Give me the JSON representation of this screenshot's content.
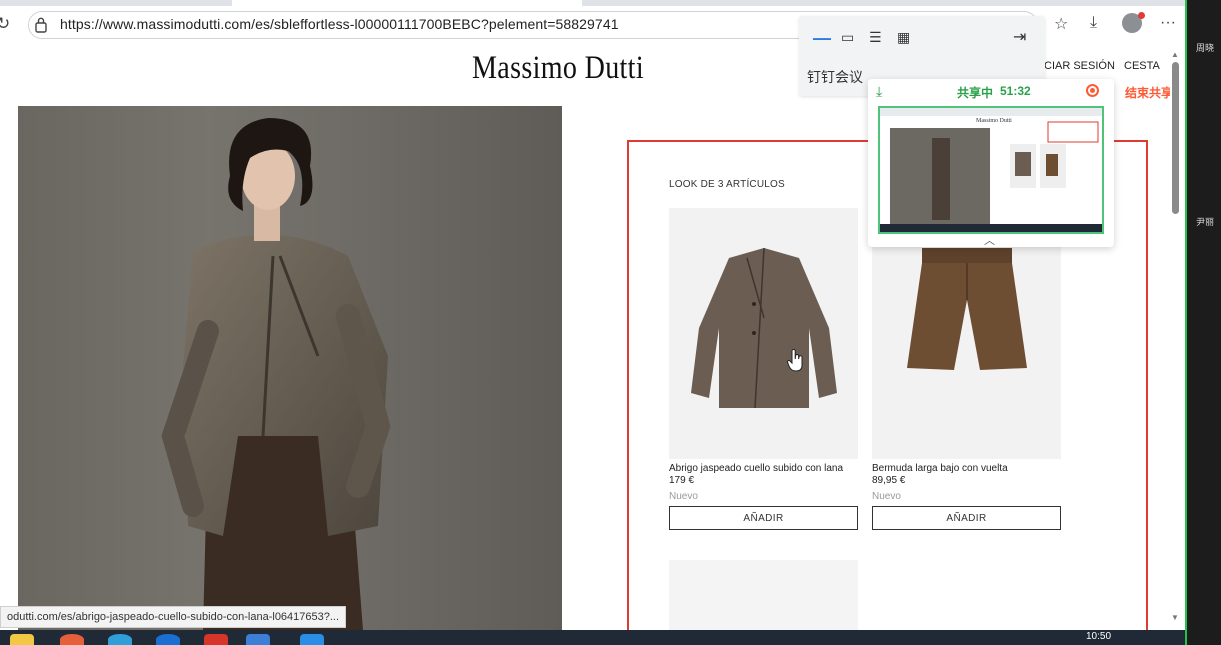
{
  "browser": {
    "url": "https://www.massimodutti.com/es/sbleffortless-l00000111700BEBC?pelement=58829741",
    "icons": [
      "reload-icon",
      "lock-icon",
      "favorites-icon",
      "downloads-icon",
      "profile-avatar",
      "more-icon"
    ],
    "more_label": "···"
  },
  "site": {
    "brand": "Massimo Dutti",
    "nav": {
      "login": "CIAR SESIÓN",
      "cart": "CESTA"
    }
  },
  "look": {
    "title": "LOOK DE 3 ARTÍCULOS",
    "products": [
      {
        "name": "Abrigo jaspeado cuello subido con lana",
        "price": "179 €",
        "badge": "Nuevo",
        "add_label": "AÑADIR"
      },
      {
        "name": "Bermuda larga bajo con vuelta",
        "price": "89,95 €",
        "badge": "Nuevo",
        "add_label": "AÑADIR"
      }
    ]
  },
  "status_link": "odutti.com/es/abrigo-jaspeado-cuello-subido-con-lana-l06417653?...",
  "dingtalk": {
    "toolbar_label": "钉钉会议",
    "share_status": "共享中",
    "share_time": "51:32",
    "end_share": "结束共享",
    "thumb_brand": "Massimo Dutti",
    "colors": {
      "accent": "#2a7be4",
      "share_green": "#2aa14a",
      "end_orange": "#ff5a36"
    }
  },
  "highlight_color": "#e03b32",
  "taskbar": {
    "clock": "10:50"
  },
  "participants": [
    "周晓",
    "尹丽"
  ]
}
